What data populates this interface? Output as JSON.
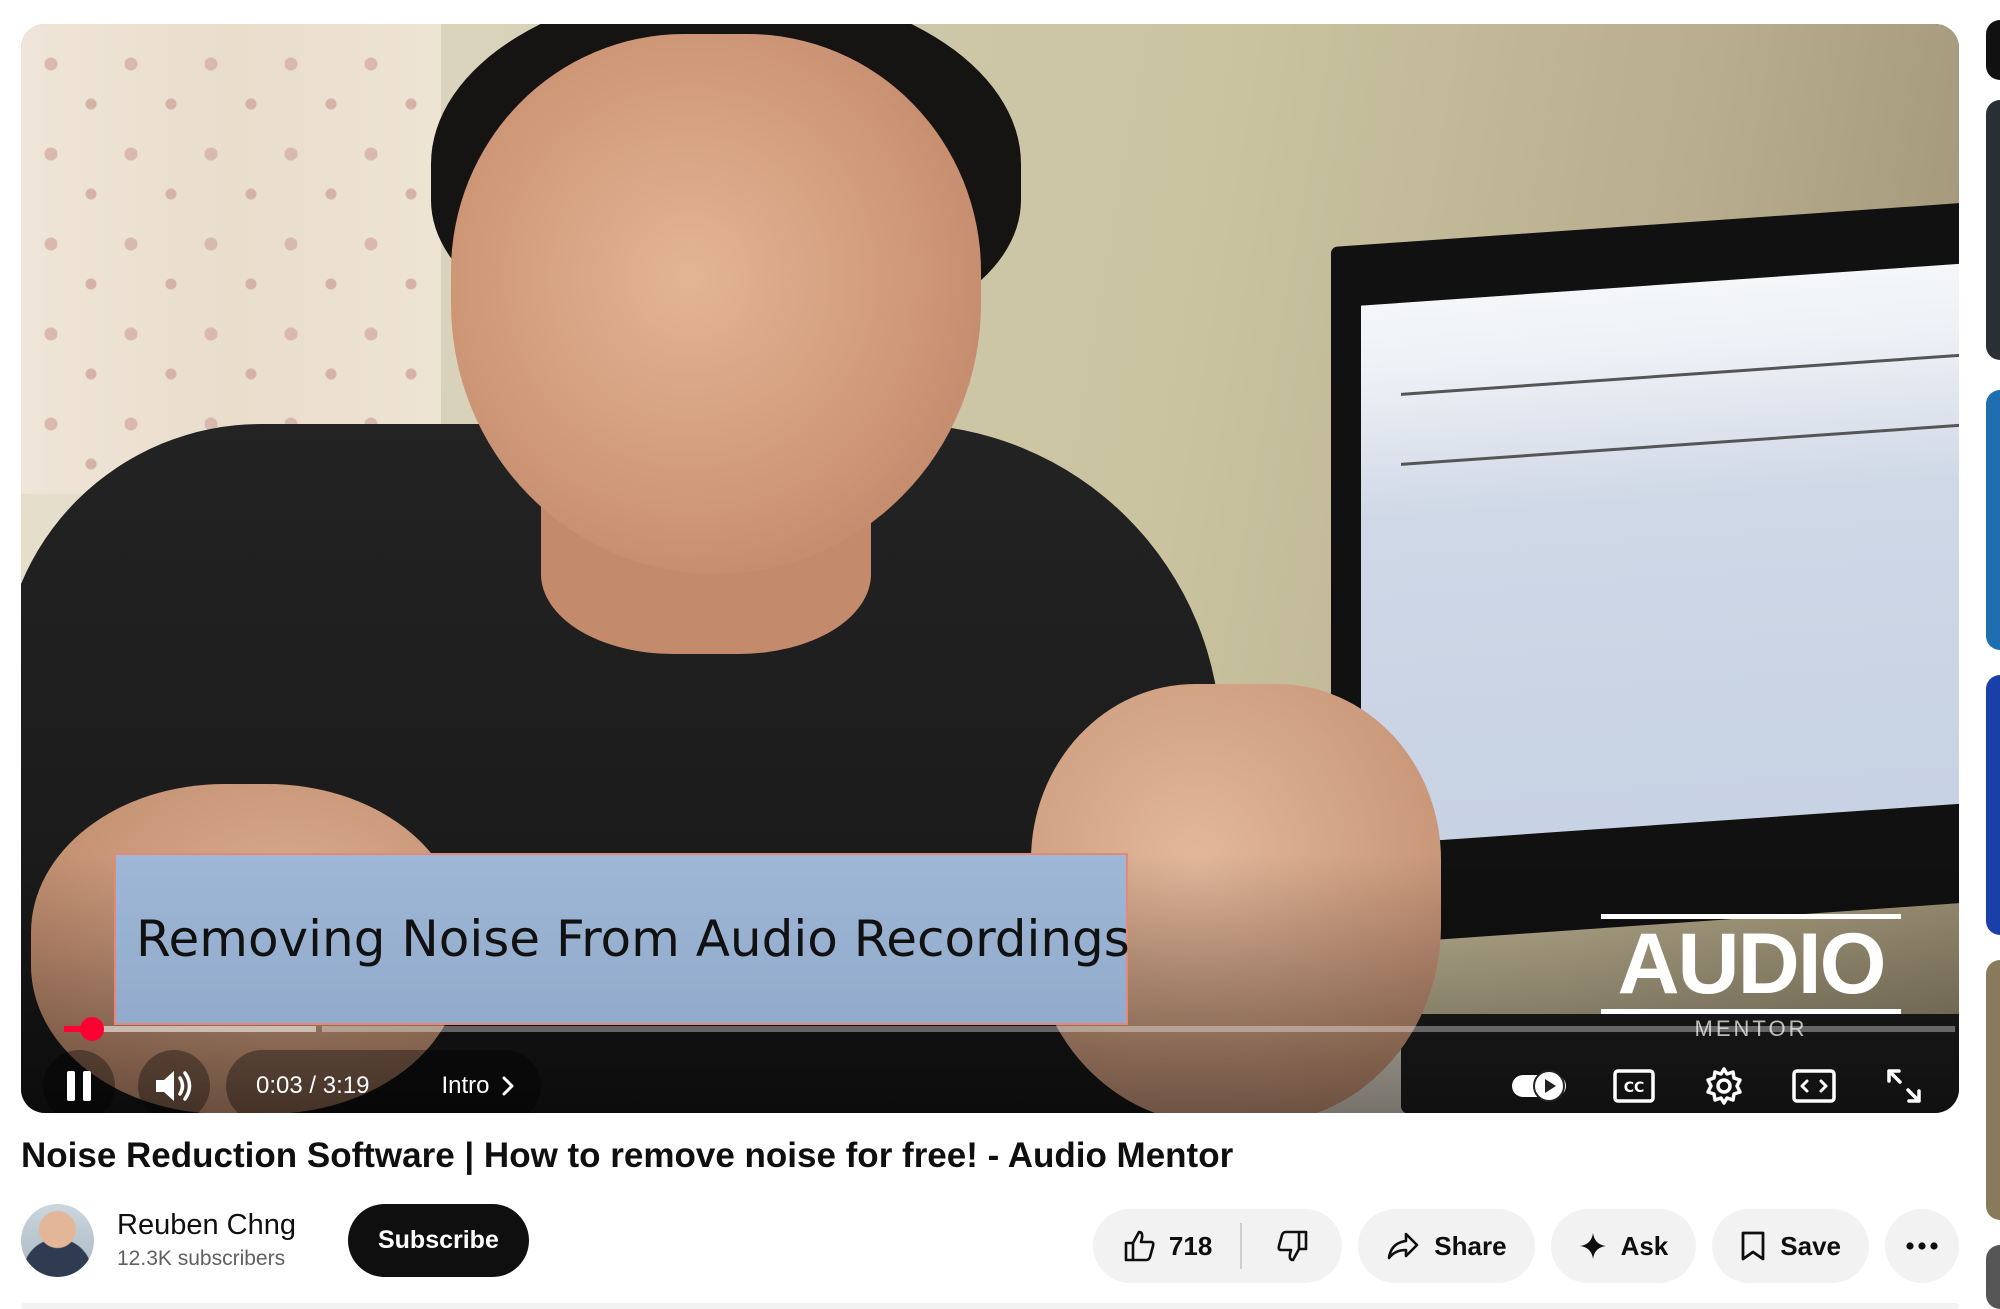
{
  "video": {
    "overlay_title": "Removing Noise From Audio Recordings",
    "watermark_top": "AUDIO",
    "watermark_bottom": "MENTOR",
    "progress_fraction": 0.015,
    "buffered_fraction": 0.14,
    "time_display": "0:03 / 3:19",
    "chapter": "Intro",
    "accent_color": "#ff0033"
  },
  "controls": {
    "pause_icon": "pause-icon",
    "volume_icon": "volume-icon",
    "autoplay_icon": "autoplay-toggle-icon",
    "captions_icon": "cc-icon",
    "settings_icon": "gear-icon",
    "theater_icon": "theater-mode-icon",
    "fullscreen_icon": "fullscreen-icon"
  },
  "title": "Noise Reduction Software | How to remove noise for free! - Audio Mentor",
  "channel": {
    "name": "Reuben Chng",
    "subscribers": "12.3K subscribers",
    "subscribe_label": "Subscribe"
  },
  "actions": {
    "like_count": "718",
    "share_label": "Share",
    "ask_label": "Ask",
    "save_label": "Save"
  }
}
